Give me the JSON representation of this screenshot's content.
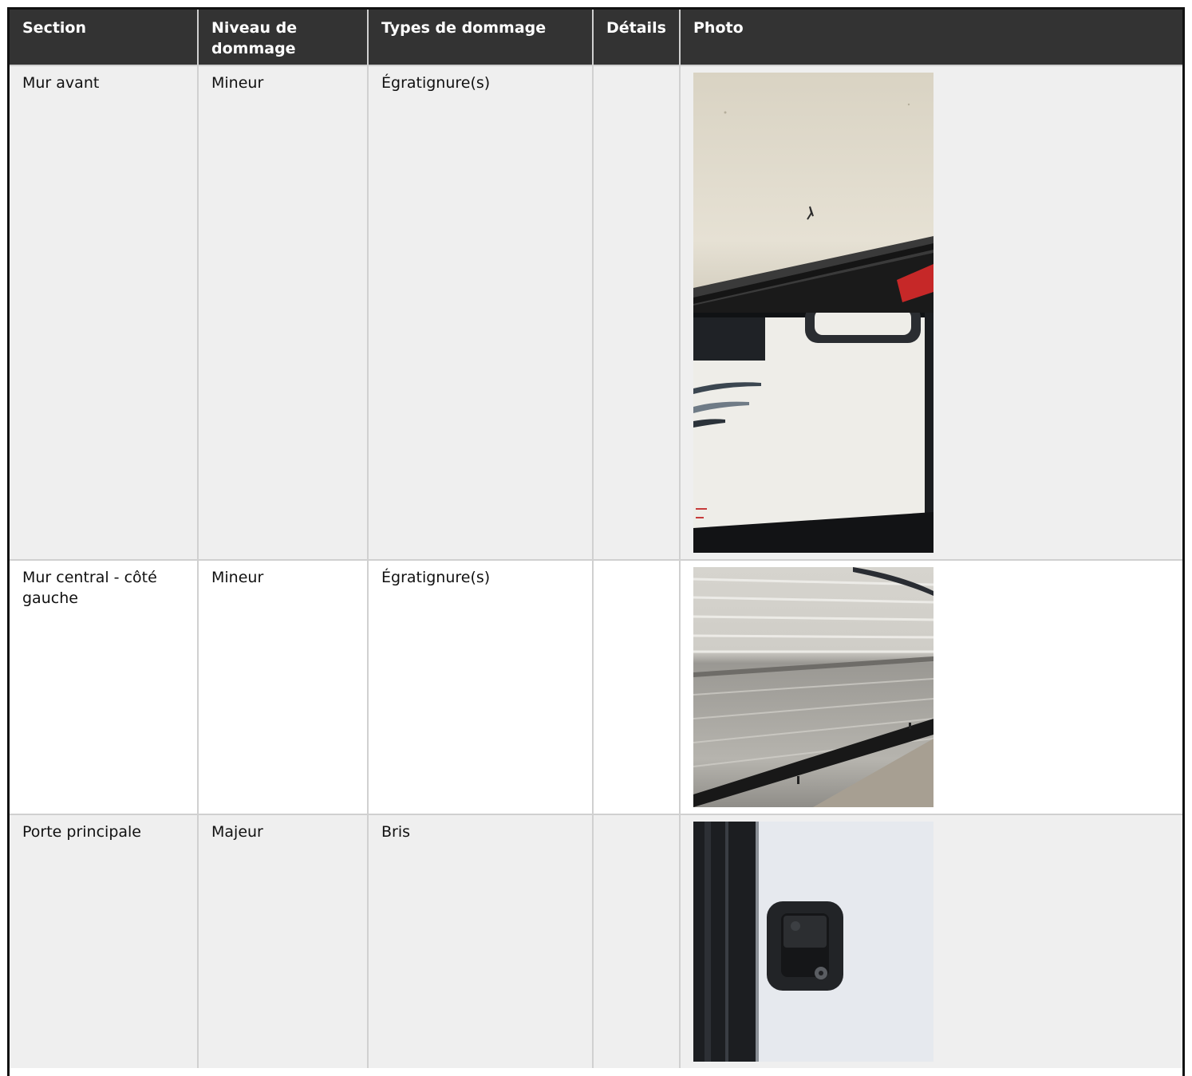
{
  "table": {
    "headers": {
      "section": "Section",
      "niveau": "Niveau de dommage",
      "types": "Types de dommage",
      "details": "Détails",
      "photo": "Photo"
    },
    "rows": [
      {
        "section": "Mur avant",
        "niveau": "Mineur",
        "types": "Égratignure(s)",
        "details": "",
        "photos": [
          "front-wall-scratch-photo",
          "front-wall-door-photo"
        ]
      },
      {
        "section": "Mur central - côté gauche",
        "niveau": "Mineur",
        "types": "Égratignure(s)",
        "details": "",
        "photos": [
          "side-wall-siding-photo"
        ]
      },
      {
        "section": "Porte principale",
        "niveau": "Majeur",
        "types": "Bris",
        "details": "",
        "photos": [
          "door-lock-photo"
        ]
      }
    ]
  }
}
